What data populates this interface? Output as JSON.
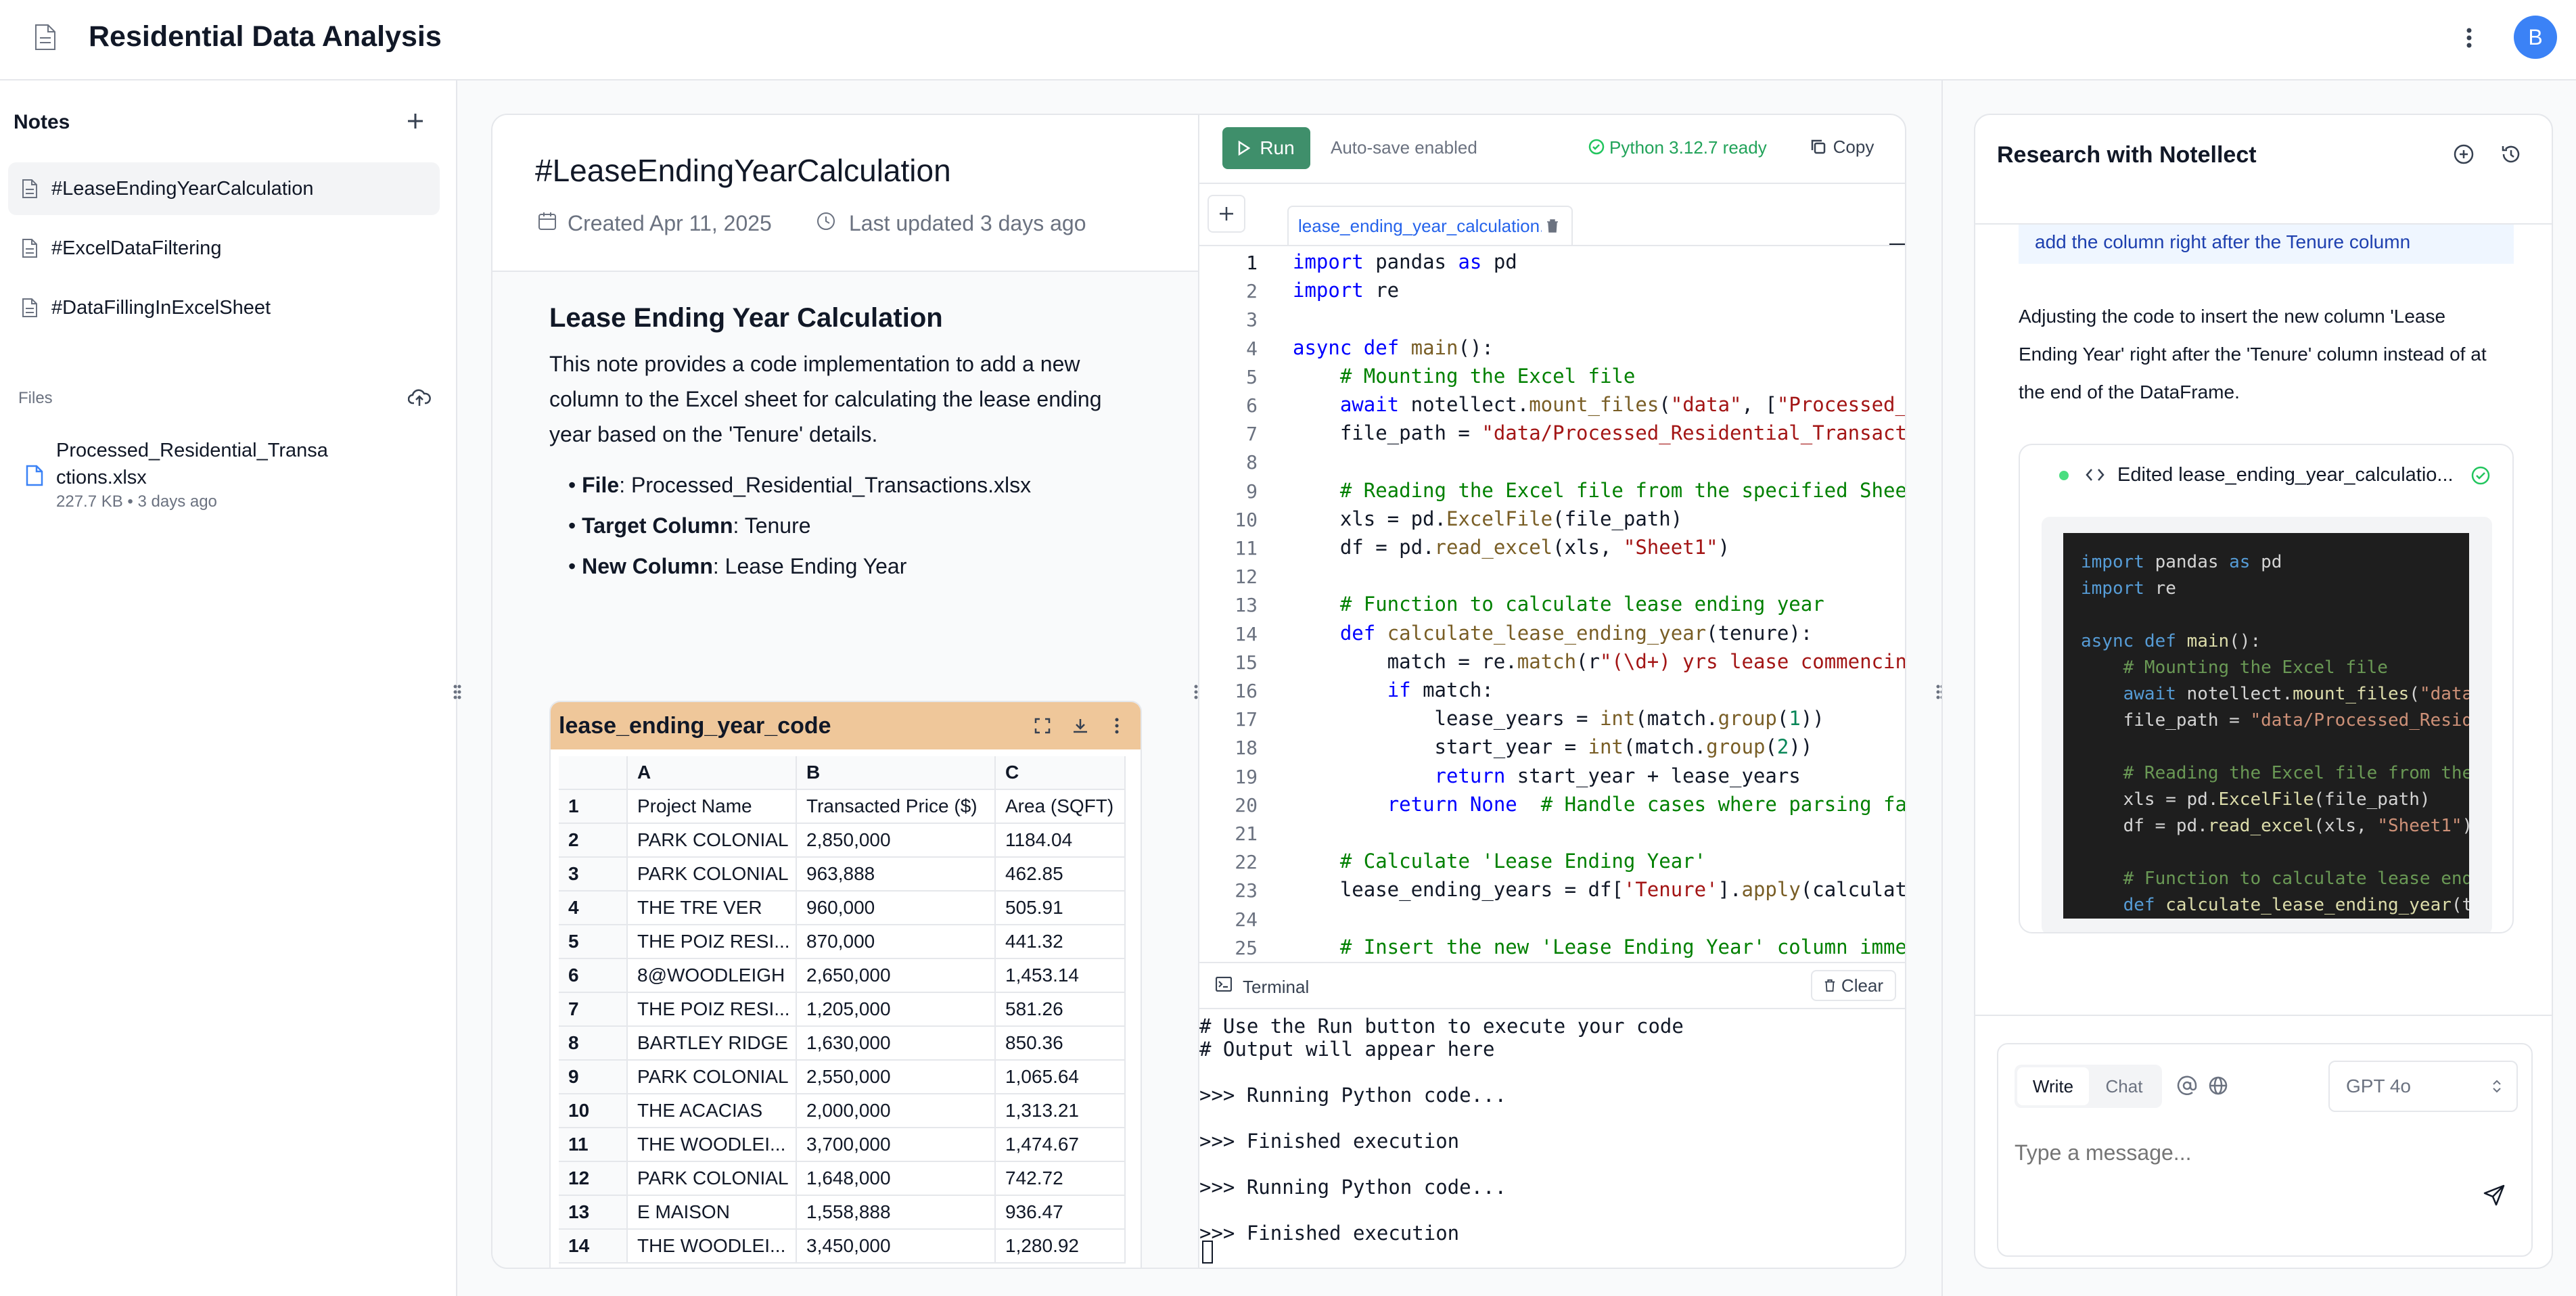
{
  "app": {
    "title": "Residential Data Analysis",
    "avatar_letter": "B"
  },
  "sidebar": {
    "notes_label": "Notes",
    "notes": [
      {
        "label": "#LeaseEndingYearCalculation",
        "active": true
      },
      {
        "label": "#ExcelDataFiltering",
        "active": false
      },
      {
        "label": "#DataFillingInExcelSheet",
        "active": false
      }
    ],
    "files_label": "Files",
    "files": [
      {
        "name_line1": "Processed_Residential_Transa",
        "name_line2": "ctions.xlsx",
        "meta": "227.7 KB • 3 days ago"
      }
    ]
  },
  "note": {
    "title": "#LeaseEndingYearCalculation",
    "created": "Created Apr 11, 2025",
    "updated": "Last updated 3 days ago",
    "heading": "Lease Ending Year Calculation",
    "para_lines": [
      "This note provides a code implementation to add a new",
      "column to the Excel sheet for calculating the lease ending",
      "year based on the 'Tenure' details."
    ],
    "bullets": [
      {
        "key": "File",
        "value": ": Processed_Residential_Transactions.xlsx"
      },
      {
        "key": "Target Column",
        "value": ": Tenure"
      },
      {
        "key": "New Column",
        "value": ": Lease Ending Year"
      }
    ],
    "sheet": {
      "title": "lease_ending_year_code",
      "columns": [
        "",
        "A",
        "B",
        "C"
      ],
      "rows": [
        [
          "1",
          "Project Name",
          "Transacted Price ($)",
          "Area (SQFT)"
        ],
        [
          "2",
          "PARK COLONIAL",
          "2,850,000",
          "1184.04"
        ],
        [
          "3",
          "PARK COLONIAL",
          "963,888",
          "462.85"
        ],
        [
          "4",
          "THE TRE VER",
          "960,000",
          "505.91"
        ],
        [
          "5",
          "THE POIZ RESI...",
          "870,000",
          "441.32"
        ],
        [
          "6",
          "8@WOODLEIGH",
          "2,650,000",
          "1,453.14"
        ],
        [
          "7",
          "THE POIZ RESI...",
          "1,205,000",
          "581.26"
        ],
        [
          "8",
          "BARTLEY RIDGE",
          "1,630,000",
          "850.36"
        ],
        [
          "9",
          "PARK COLONIAL",
          "2,550,000",
          "1,065.64"
        ],
        [
          "10",
          "THE ACACIAS",
          "2,000,000",
          "1,313.21"
        ],
        [
          "11",
          "THE WOODLEI...",
          "3,700,000",
          "1,474.67"
        ],
        [
          "12",
          "PARK COLONIAL",
          "1,648,000",
          "742.72"
        ],
        [
          "13",
          "E MAISON",
          "1,558,888",
          "936.47"
        ],
        [
          "14",
          "THE WOODLEI...",
          "3,450,000",
          "1,280.92"
        ]
      ]
    }
  },
  "editor": {
    "run_label": "Run",
    "autosave": "Auto-save enabled",
    "python_status": "Python 3.12.7 ready",
    "copy_label": "Copy",
    "tab_name": "lease_ending_year_calculation.p",
    "lines": [
      "import pandas as pd",
      "import re",
      "",
      "async def main():",
      "    # Mounting the Excel file",
      "    await notellect.mount_files(\"data\", [\"Processed_Re",
      "    file_path = \"data/Processed_Residential_Transactio",
      "",
      "    # Reading the Excel file from the specified Sheet",
      "    xls = pd.ExcelFile(file_path)",
      "    df = pd.read_excel(xls, \"Sheet1\")",
      "",
      "    # Function to calculate lease ending year",
      "    def calculate_lease_ending_year(tenure):",
      "        match = re.match(r\"(\\d+) yrs lease commencing",
      "        if match:",
      "            lease_years = int(match.group(1))",
      "            start_year = int(match.group(2))",
      "            return start_year + lease_years",
      "        return None  # Handle cases where parsing fail",
      "",
      "    # Calculate 'Lease Ending Year'",
      "    lease_ending_years = df['Tenure'].apply(calculate_",
      "",
      "    # Insert the new 'Lease Ending Year' column immedi"
    ],
    "terminal_label": "Terminal",
    "clear_label": "Clear",
    "terminal_lines": [
      "# Use the Run button to execute your code",
      "# Output will appear here",
      "",
      ">>> Running Python code...",
      "",
      ">>> Finished execution",
      "",
      ">>> Running Python code...",
      "",
      ">>> Finished execution"
    ]
  },
  "research": {
    "title": "Research with Notellect",
    "user_message": "add the column right after the Tenure column",
    "assistant_lines": [
      "Adjusting the code to insert the new column 'Lease",
      "Ending Year' right after the 'Tenure' column instead of at",
      "the end of the DataFrame."
    ],
    "edit_card_title": "Edited lease_ending_year_calculatio...",
    "preview_lines": [
      "import pandas as pd",
      "import re",
      "",
      "async def main():",
      "    # Mounting the Excel file",
      "    await notellect.mount_files(\"data",
      "    file_path = \"data/Processed_Resid",
      "",
      "    # Reading the Excel file from the",
      "    xls = pd.ExcelFile(file_path)",
      "    df = pd.read_excel(xls, \"Sheet1\")",
      "",
      "    # Function to calculate lease end",
      "    def calculate_lease_ending_year(t"
    ],
    "mode_write": "Write",
    "mode_chat": "Chat",
    "model": "GPT 4o",
    "input_placeholder": "Type a message..."
  },
  "colors": {
    "accent": "#3b82f6",
    "run_green": "#3f8f6b",
    "sheet_header": "#efc79a",
    "status_green": "#22c55e"
  }
}
